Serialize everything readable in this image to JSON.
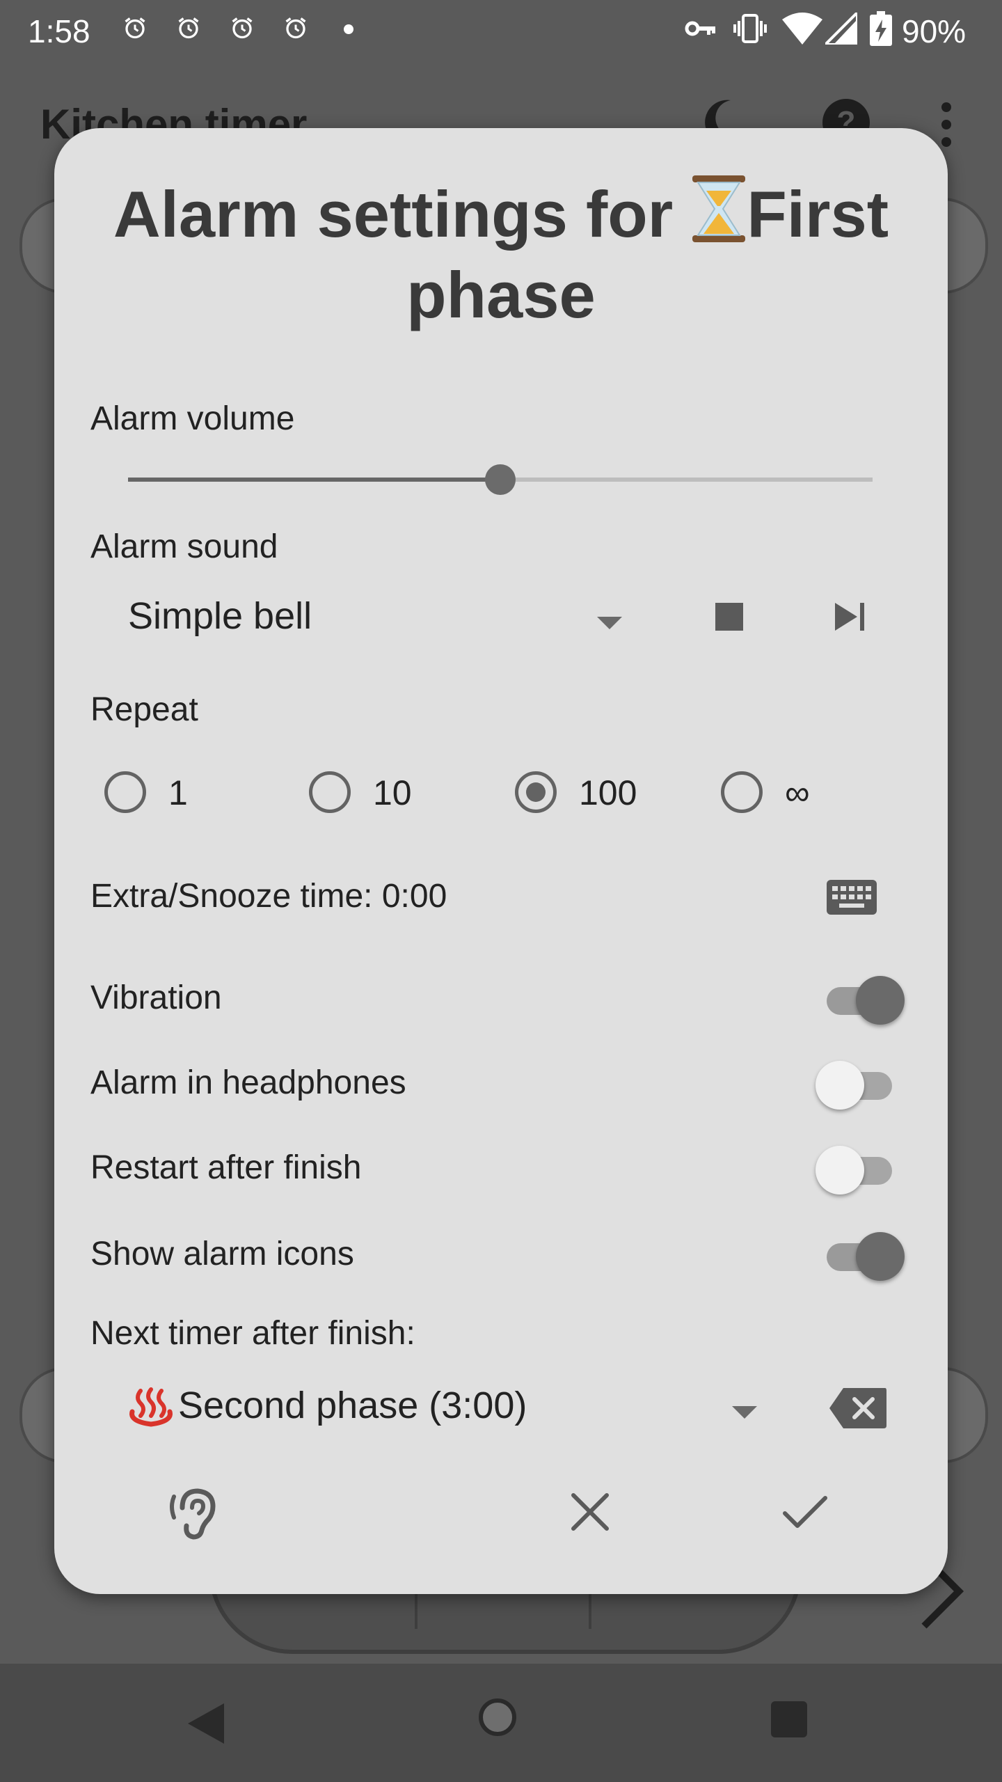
{
  "status_bar": {
    "time": "1:58",
    "battery": "90%",
    "icons": [
      "alarm-icon",
      "alarm-icon",
      "alarm-icon",
      "alarm-icon",
      "dot-icon",
      "vpn-key-icon",
      "vibrate-icon",
      "wifi-icon",
      "signal-icon",
      "battery-charging-icon"
    ]
  },
  "background_app": {
    "title": "Kitchen timer",
    "icons": [
      "night-mode-icon",
      "help-icon",
      "overflow-menu-icon"
    ]
  },
  "dialog": {
    "title_prefix": "Alarm settings for ",
    "title_emoji": "⏳",
    "title_name": "First phase",
    "volume": {
      "label": "Alarm volume",
      "level": 0.5
    },
    "sound": {
      "label": "Alarm sound",
      "selected": "Simple bell"
    },
    "repeat": {
      "label": "Repeat",
      "options": [
        "1",
        "10",
        "100",
        "∞"
      ],
      "selected_index": 2
    },
    "snooze": {
      "label": "Extra/Snooze time: 0:00"
    },
    "toggles": [
      {
        "label": "Vibration",
        "on": true
      },
      {
        "label": "Alarm in headphones",
        "on": false
      },
      {
        "label": "Restart after finish",
        "on": false
      },
      {
        "label": "Show alarm icons",
        "on": true
      }
    ],
    "next_timer": {
      "label": "Next timer after finish:",
      "emoji": "♨️",
      "selected": "Second phase (3:00)"
    }
  },
  "colors": {
    "dialog_bg": "#e0e0e0",
    "accent": "#6a6a6a",
    "scrim": "#5a5a5a"
  }
}
